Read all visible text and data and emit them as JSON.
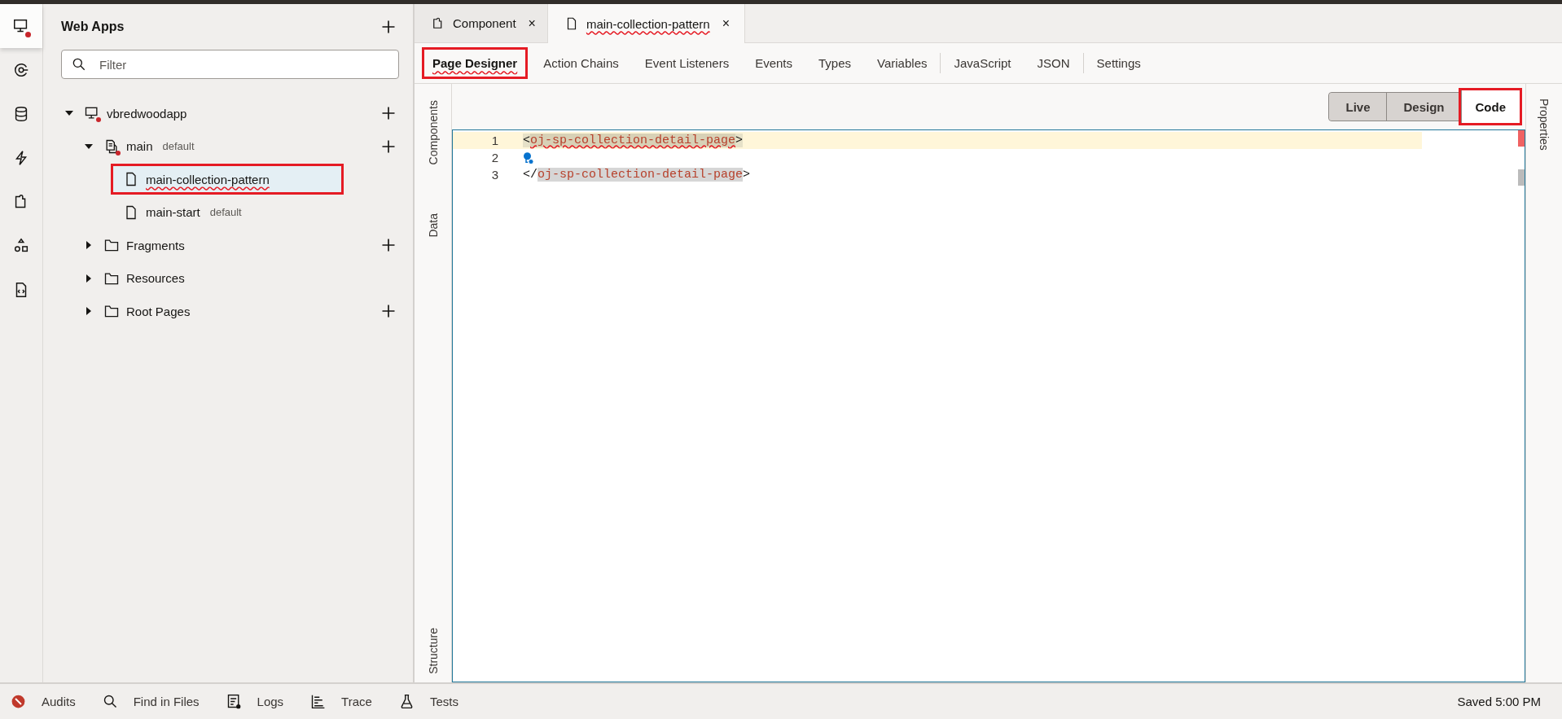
{
  "activity_bar": [
    {
      "kind": "monitor",
      "selected": true,
      "alert": true
    },
    {
      "kind": "service",
      "selected": false,
      "alert": false
    },
    {
      "kind": "database",
      "selected": false,
      "alert": false
    },
    {
      "kind": "bolt",
      "selected": false,
      "alert": false
    },
    {
      "kind": "puzzle",
      "selected": false,
      "alert": false
    },
    {
      "kind": "shapes",
      "selected": false,
      "alert": false
    },
    {
      "kind": "code-file",
      "selected": false,
      "alert": false
    }
  ],
  "explorer": {
    "title": "Web Apps",
    "filter": {
      "placeholder": "Filter"
    },
    "tree": [
      {
        "kind": "app",
        "label": "vbredwoodapp",
        "alert": true,
        "expanded": true,
        "add_button": true,
        "selected": false,
        "children": [
          {
            "kind": "flow",
            "label": "main",
            "badge": "default",
            "alert": true,
            "expanded": true,
            "add_button": true,
            "selected": false,
            "children": [
              {
                "kind": "page",
                "label": "main-collection-pattern",
                "selected": true,
                "annotated": true,
                "spell_error": true,
                "add_button": false
              },
              {
                "kind": "page",
                "label": "main-start",
                "badge": "default",
                "selected": false,
                "add_button": false
              }
            ]
          },
          {
            "kind": "folder",
            "label": "Fragments",
            "expanded": false,
            "add_button": true,
            "selected": false
          },
          {
            "kind": "folder",
            "label": "Resources",
            "expanded": false,
            "add_button": false,
            "selected": false
          },
          {
            "kind": "folder",
            "label": "Root Pages",
            "expanded": false,
            "add_button": true,
            "selected": false
          }
        ]
      }
    ]
  },
  "editor_tabs": [
    {
      "kind": "puzzle",
      "label": "Component",
      "selected": false,
      "spell_error": false,
      "close": "×"
    },
    {
      "kind": "page",
      "label": "main-collection-pattern",
      "selected": true,
      "spell_error": true,
      "close": "×"
    }
  ],
  "designer_tabs": [
    {
      "label": "Page Designer",
      "selected": true,
      "annotated": true,
      "spell_error": true,
      "separator_before": false
    },
    {
      "label": "Action Chains",
      "selected": false,
      "separator_before": false
    },
    {
      "label": "Event Listeners",
      "selected": false,
      "separator_before": false
    },
    {
      "label": "Events",
      "selected": false,
      "separator_before": false
    },
    {
      "label": "Types",
      "selected": false,
      "separator_before": false
    },
    {
      "label": "Variables",
      "selected": false,
      "separator_before": false
    },
    {
      "label": "JavaScript",
      "selected": false,
      "separator_before": true
    },
    {
      "label": "JSON",
      "selected": false,
      "separator_before": false
    },
    {
      "label": "Settings",
      "selected": false,
      "separator_before": true
    }
  ],
  "left_panels": [
    "Components",
    "Data",
    "Structure"
  ],
  "right_panels": [
    "Properties"
  ],
  "view_modes": [
    {
      "label": "Live",
      "selected": false,
      "annotated": false
    },
    {
      "label": "Design",
      "selected": false,
      "annotated": false
    },
    {
      "label": "Code",
      "selected": true,
      "annotated": true
    }
  ],
  "code": {
    "lines": [
      {
        "number": "1",
        "open": "<",
        "tag": "oj-sp-collection-detail-page",
        "close": ">",
        "current": true,
        "hint": false
      },
      {
        "number": "2",
        "current": false,
        "hint": true
      },
      {
        "number": "3",
        "open": "</",
        "tag": "oj-sp-collection-detail-page",
        "close": ">",
        "current": false,
        "hint": false
      }
    ]
  },
  "status_bar": {
    "tools": [
      {
        "kind": "audits",
        "label": "Audits"
      },
      {
        "kind": "search",
        "label": "Find in Files"
      },
      {
        "kind": "logs",
        "label": "Logs"
      },
      {
        "kind": "trace",
        "label": "Trace"
      },
      {
        "kind": "flask",
        "label": "Tests"
      }
    ],
    "status": "Saved 5:00 PM"
  }
}
